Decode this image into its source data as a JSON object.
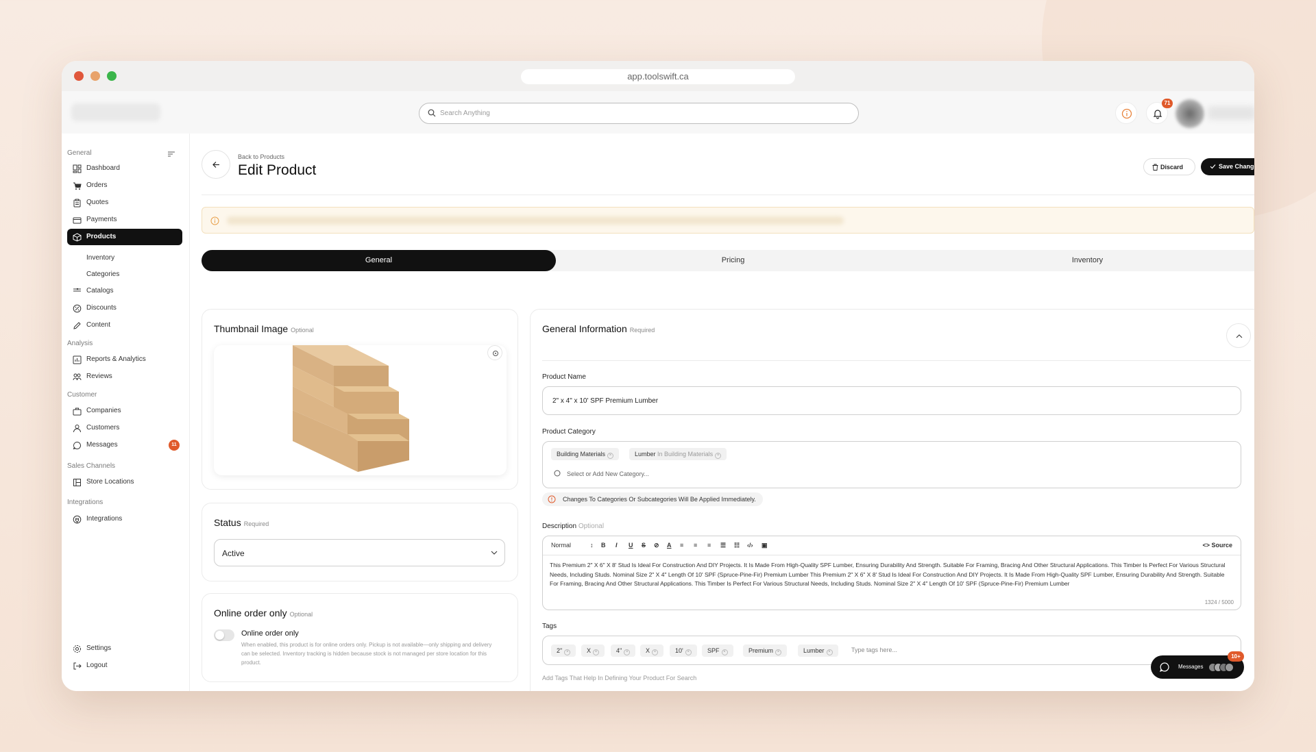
{
  "browser": {
    "url": "app.toolswift.ca"
  },
  "topbar": {
    "search_placeholder": "Search Anything",
    "notification_count": "71"
  },
  "sidebar": {
    "sections": {
      "general": "General",
      "analysis": "Analysis",
      "customer": "Customer",
      "sales_channels": "Sales Channels",
      "integrations": "Integrations"
    },
    "items": {
      "dashboard": "Dashboard",
      "orders": "Orders",
      "quotes": "Quotes",
      "payments": "Payments",
      "products": "Products",
      "inventory": "Inventory",
      "categories": "Categories",
      "catalogs": "Catalogs",
      "discounts": "Discounts",
      "content": "Content",
      "reports": "Reports & Analytics",
      "reviews": "Reviews",
      "companies": "Companies",
      "customers": "Customers",
      "messages": "Messages",
      "store_locations": "Store Locations",
      "integrations": "Integrations",
      "settings": "Settings",
      "logout": "Logout"
    },
    "messages_badge": "11"
  },
  "header": {
    "breadcrumb": "Back to Products",
    "title": "Edit Product",
    "discard_label": "Discard",
    "save_label": "Save Changes"
  },
  "tabs": [
    "General",
    "Pricing",
    "Inventory"
  ],
  "thumbnail": {
    "title": "Thumbnail Image",
    "tag": "Optional"
  },
  "status": {
    "title": "Status",
    "tag": "Required",
    "value": "Active"
  },
  "online_order": {
    "title": "Online order only",
    "tag": "Optional",
    "toggle_label": "Online order only",
    "toggle_description": "When enabled, this product is for online orders only. Pickup is not available—only shipping and delivery can be selected. Inventory tracking is hidden because stock is not managed per store location for this product.",
    "enabled": false
  },
  "general_info": {
    "title": "General Information",
    "tag": "Required",
    "product_name_label": "Product Name",
    "product_name": "2\" x 4\" x 10' SPF Premium Lumber",
    "category_label": "Product Category",
    "category_chips": [
      {
        "name": "Building Materials",
        "sub": ""
      },
      {
        "name": "Lumber",
        "sub": "In Building Materials"
      }
    ],
    "category_placeholder": "Select or Add New Category...",
    "category_notice": "Changes To Categories Or Subcategories Will Be Applied Immediately.",
    "description_label": "Description",
    "description_tag": "Optional",
    "editor_format": "Normal",
    "editor_source": "<> Source",
    "description_text": "This Premium 2\" X 6\" X 8' Stud Is Ideal For Construction And DIY Projects. It Is Made From High-Quality SPF Lumber, Ensuring Durability And Strength. Suitable For Framing, Bracing And Other Structural Applications. This Timber Is Perfect For Various Structural Needs, Including Studs. Nominal Size 2\" X 4\" Length Of 10' SPF (Spruce-Pine-Fir) Premium Lumber This Premium 2\" X 6\" X 8' Stud Is Ideal For Construction And DIY Projects. It Is Made From High-Quality SPF Lumber, Ensuring Durability And Strength. Suitable For Framing, Bracing And Other Structural Applications. This Timber Is Perfect For Various Structural Needs, Including Studs. Nominal Size 2\" X 4\" Length Of 10' SPF (Spruce-Pine-Fir) Premium Lumber",
    "char_count": "1324 / 5000",
    "tags_label": "Tags",
    "tags": [
      "2\"",
      "X",
      "4\"",
      "X",
      "10'",
      "SPF",
      "Premium",
      "Lumber"
    ],
    "tags_placeholder": "Type tags here...",
    "tags_hint": "Add Tags That Help In Defining Your Product For Search"
  },
  "messages_widget": {
    "label": "Messages",
    "badge": "10+"
  },
  "colors": {
    "accent": "#e05a2b",
    "dark": "#111111"
  }
}
